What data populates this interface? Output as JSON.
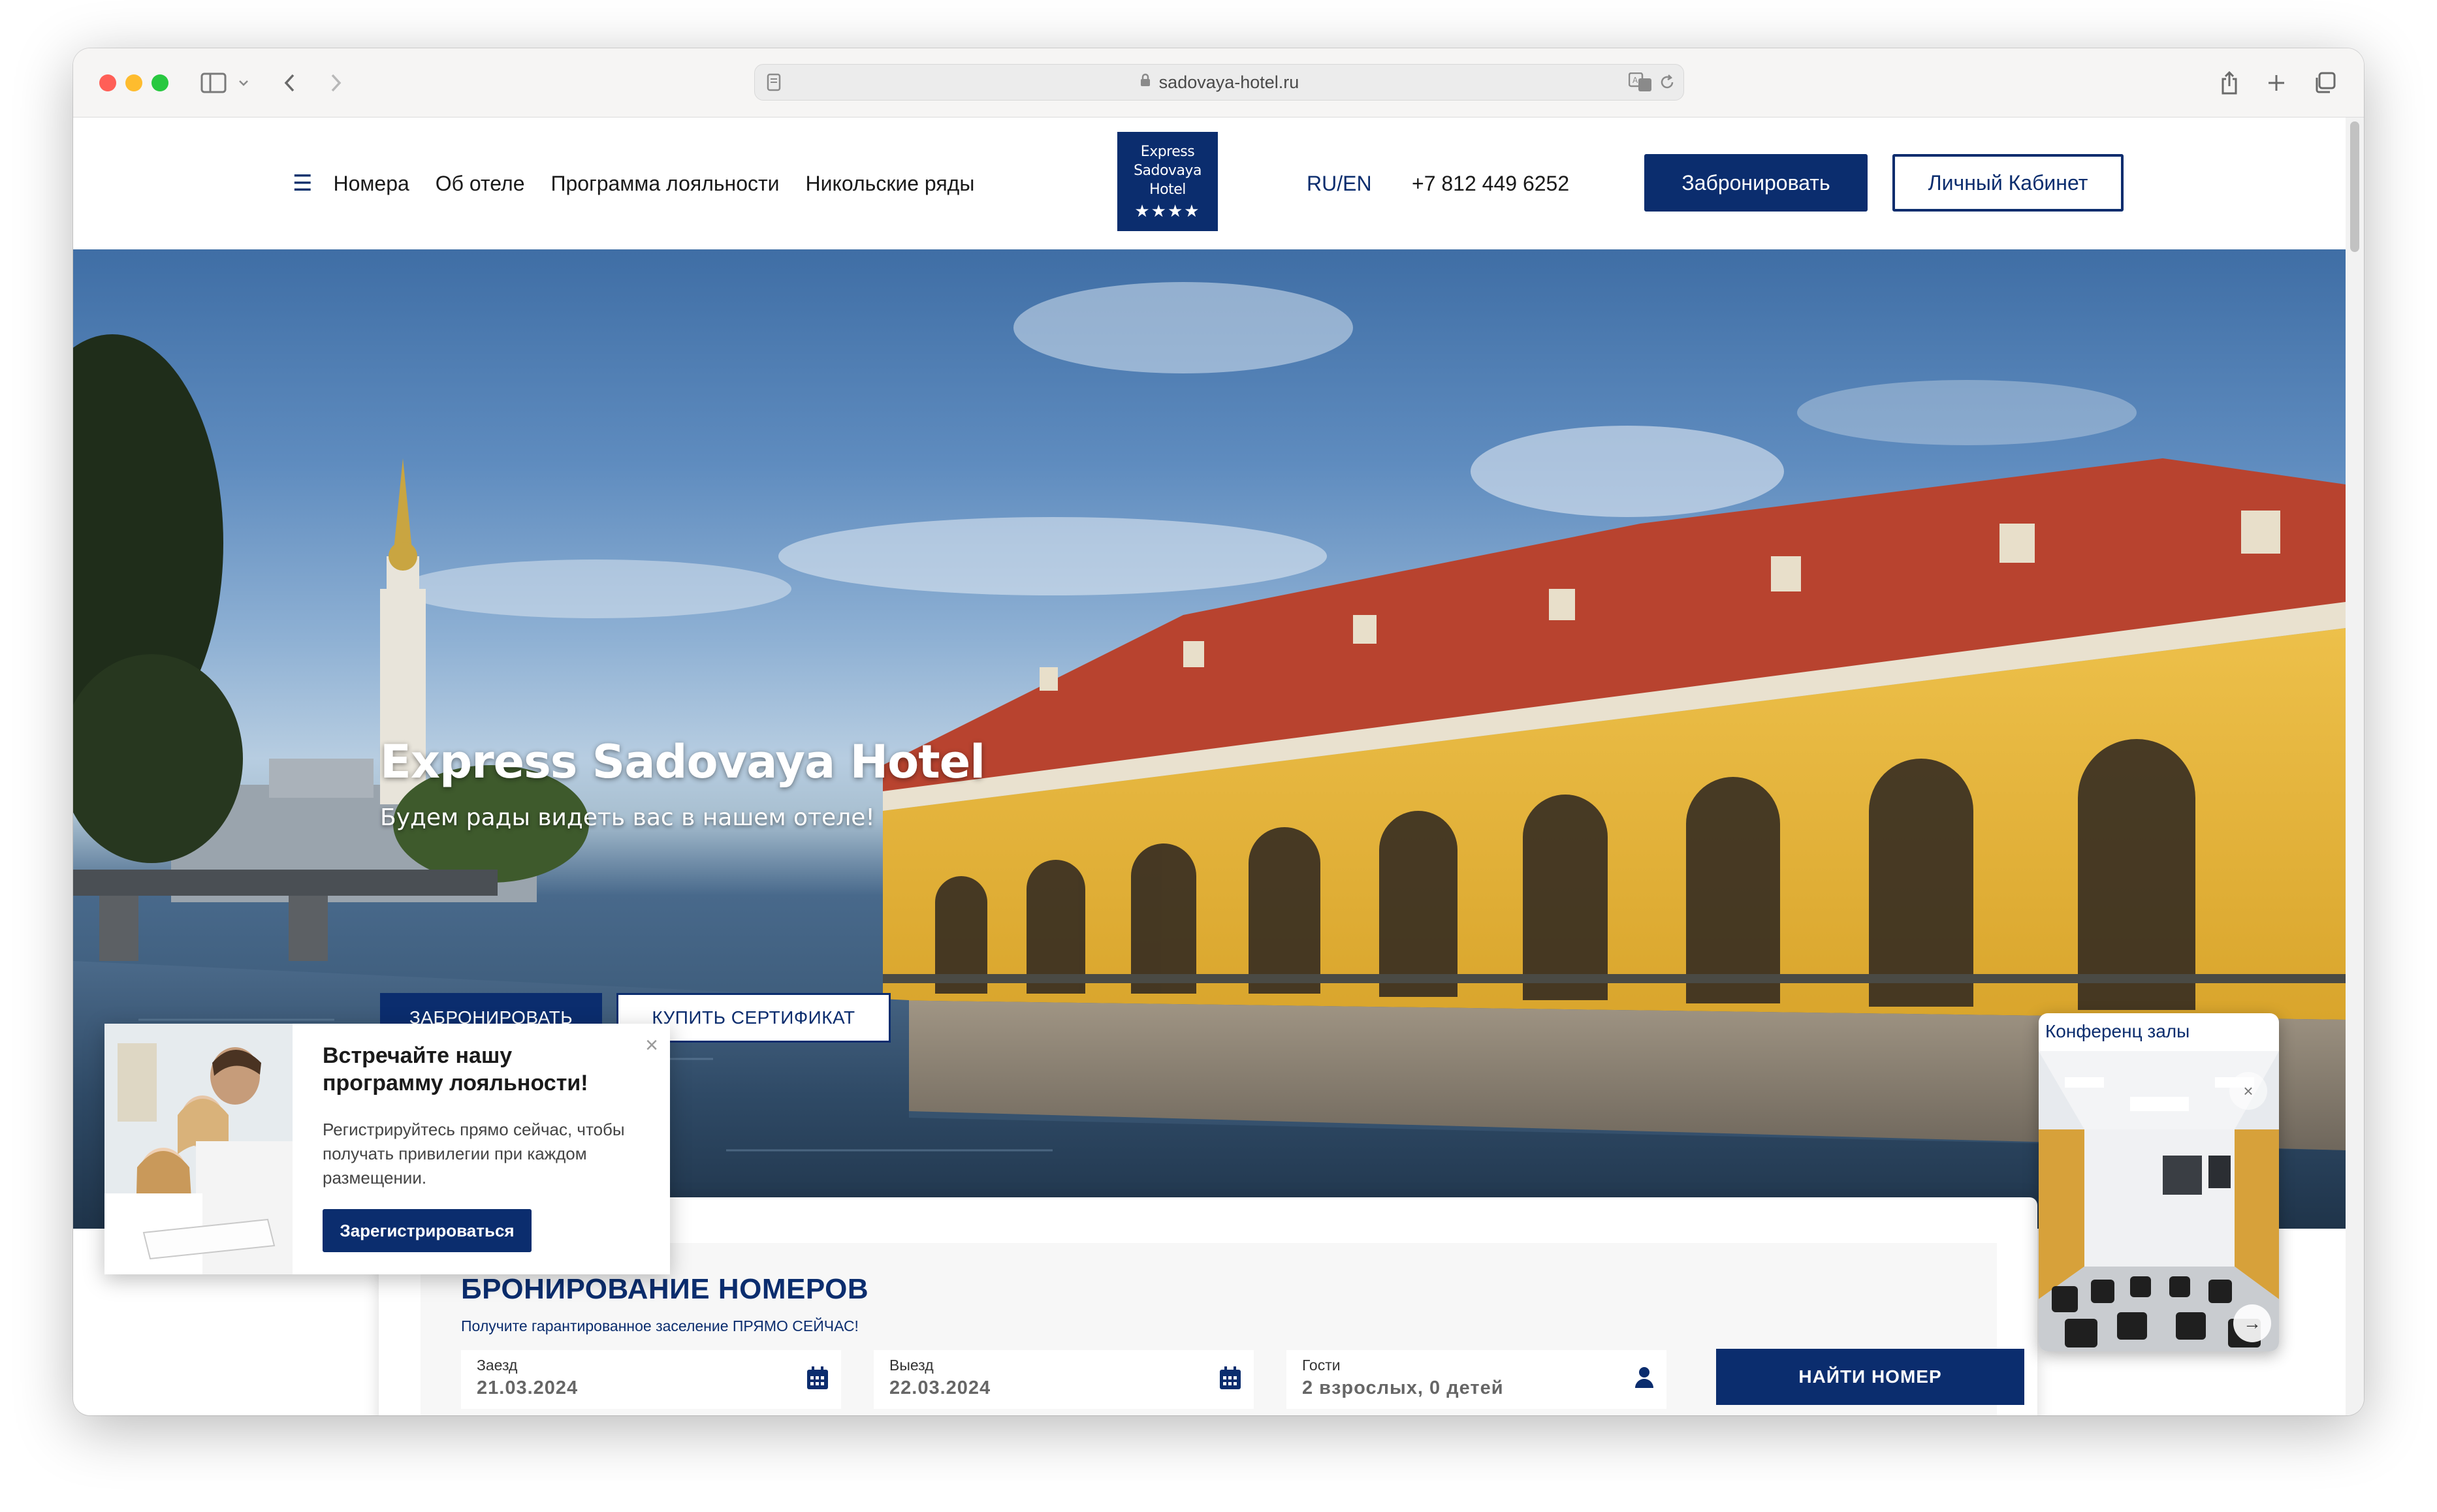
{
  "browser": {
    "url": "sadovaya-hotel.ru"
  },
  "header": {
    "nav": [
      "Номера",
      "Об отеле",
      "Программа лояльности",
      "Никольские ряды"
    ],
    "logo_lines": [
      "Express",
      "Sadovaya",
      "Hotel"
    ],
    "logo_stars": "★★★★",
    "lang": "RU/EN",
    "phone": "+7 812 449 6252",
    "book_label": "Забронировать",
    "cabinet_label": "Личный Кабинет"
  },
  "hero": {
    "title": "Express Sadovaya Hotel",
    "subtitle": "Будем рады видеть вас в нашем отеле!",
    "book_button": "ЗАБРОНИРОВАТЬ",
    "certificate_button": "КУПИТЬ СЕРТИФИКАТ"
  },
  "loyalty_popup": {
    "title": "Встречайте нашу программу лояльности!",
    "text": "Регистрируйтесь прямо сейчас, чтобы получать привилегии при каждом размещении.",
    "button": "Зарегистрироваться",
    "close": "×"
  },
  "booking": {
    "title": "БРОНИРОВАНИЕ НОМЕРОВ",
    "subtitle": "Получите гарантированное заселение ПРЯМО СЕЙЧАС!",
    "checkin_label": "Заезд",
    "checkin_value": "21.03.2024",
    "checkout_label": "Выезд",
    "checkout_value": "22.03.2024",
    "guests_label": "Гости",
    "guests_value": "2 взрослых, 0 детей",
    "search_button": "НАЙТИ НОМЕР"
  },
  "conference": {
    "title": "Конференц залы",
    "close": "×",
    "next": "→"
  },
  "colors": {
    "brand": "#0b2d6e",
    "facade": "#e6b63a",
    "roof": "#b8432f"
  }
}
